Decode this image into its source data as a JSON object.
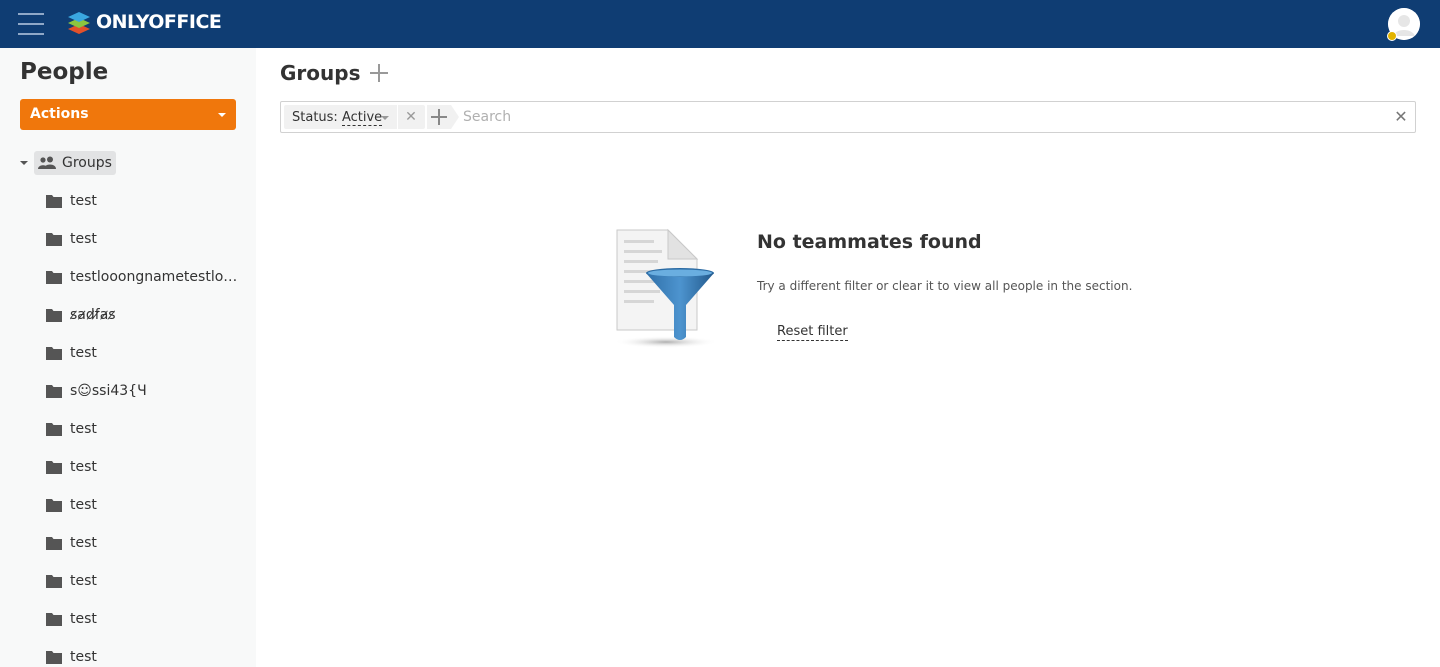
{
  "header": {
    "logo_text": "ONLYOFFICE",
    "avatar_badge_color": "#e2b400",
    "background_color": "#0f3d73"
  },
  "sidebar": {
    "title": "People",
    "actions_label": "Actions",
    "actions_color": "#f0770c",
    "tree_root_label": "Groups",
    "groups": [
      {
        "label": "test"
      },
      {
        "label": "test"
      },
      {
        "label": "testlooongnametestlooongname"
      },
      {
        "label": "s̷a̷d̷f̷a̷s̷"
      },
      {
        "label": "test"
      },
      {
        "label": "s☺ssi43{Ч"
      },
      {
        "label": "test"
      },
      {
        "label": "test"
      },
      {
        "label": "test"
      },
      {
        "label": "test"
      },
      {
        "label": "test"
      },
      {
        "label": "test"
      },
      {
        "label": "test"
      }
    ]
  },
  "main": {
    "title": "Groups",
    "filter": {
      "chip_key": "Status:",
      "chip_value": "Active",
      "search_placeholder": "Search"
    },
    "empty_state": {
      "title": "No teammates found",
      "description": "Try a different filter or clear it to view all people in the section.",
      "reset_label": "Reset filter"
    }
  }
}
